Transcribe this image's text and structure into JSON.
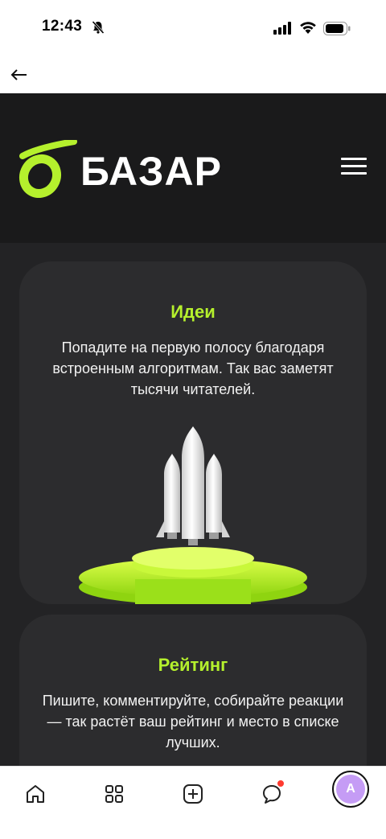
{
  "status_bar": {
    "time": "12:43"
  },
  "icons": {
    "bell": "bell-slash-icon",
    "signal": "cellular-signal-icon",
    "wifi": "wifi-icon",
    "battery": "battery-icon",
    "back": "arrow-left-icon",
    "menu": "hamburger-menu-icon",
    "home": "home-icon",
    "grid": "grid-icon",
    "add": "plus-square-icon",
    "chat": "chat-bubble-icon"
  },
  "header": {
    "logo_text": "БАЗАР"
  },
  "cards": [
    {
      "title": "Идеи",
      "text": "Попадите на первую полосу благодаря встроенным алгоритмам. Так вас заметят тысячи читателей."
    },
    {
      "title": "Рейтинг",
      "text": "Пишите, комментируйте, собирайте реакции — так растёт ваш рейтинг и место в списке лучших."
    }
  ],
  "tab_bar": {
    "avatar_letter": "A"
  },
  "colors": {
    "accent": "#b5f02d",
    "header_bg": "#1a1a1b",
    "content_bg": "#232325",
    "card_bg": "#2c2c2e",
    "avatar": "#c59cf5",
    "notification": "#ff3b30"
  }
}
